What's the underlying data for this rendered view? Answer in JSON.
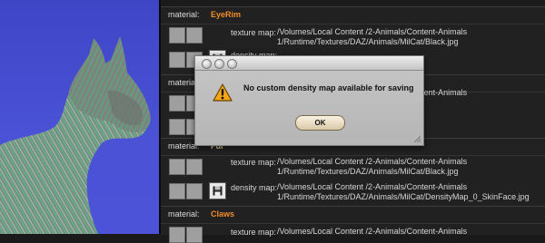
{
  "materials": [
    {
      "label": "material:",
      "name": "EyeRim",
      "textures": [
        {
          "label": "texture map:",
          "path_line1": "/Volumes/Local Content /2-Animals/Content-Animals",
          "path_line2": "1/Runtime/Textures/DAZ/Animals/MilCat/Black.jpg"
        },
        {
          "label": "density map:",
          "path_line1": "",
          "path_line2": ""
        }
      ]
    },
    {
      "label": "material:",
      "name": "",
      "textures": [
        {
          "label": "",
          "path_line1": "/Volumes/Local Content /2-Animals/Content-Animals",
          "path_line2": ""
        }
      ]
    },
    {
      "label": "material:",
      "name": "Fur",
      "textures": [
        {
          "label": "texture map:",
          "path_line1": "/Volumes/Local Content /2-Animals/Content-Animals",
          "path_line2": "1/Runtime/Textures/DAZ/Animals/MilCat/Black.jpg"
        },
        {
          "label": "density map:",
          "path_line1": "/Volumes/Local Content /2-Animals/Content-Animals",
          "path_line2": "1/Runtime/Textures/DAZ/Animals/MilCat/DensityMap_0_SkinFace.jpg"
        }
      ]
    },
    {
      "label": "material:",
      "name": "Claws",
      "textures": [
        {
          "label": "texture map:",
          "path_line1": "/Volumes/Local Content /2-Animals/Content-Animals",
          "path_line2": ""
        }
      ]
    }
  ],
  "dialog": {
    "message": "No custom density map available for saving",
    "ok_label": "OK",
    "icon": "warning-icon"
  },
  "colors": {
    "viewport_bg": "#4b52d6",
    "material_name": "#f08c2a",
    "fur_strands": "#2ee07a"
  }
}
